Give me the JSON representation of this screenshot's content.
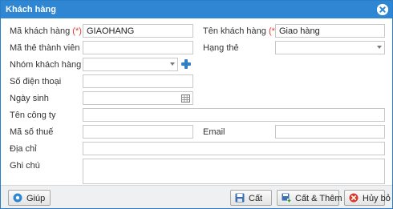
{
  "window": {
    "title": "Khách hàng"
  },
  "form": {
    "customer_code": {
      "label": "Mã khách hàng",
      "required_mark": "(*)",
      "value": "GIAOHANG"
    },
    "customer_name": {
      "label": "Tên khách hàng",
      "required_mark": "(*)",
      "value": "Giao hàng"
    },
    "member_card_code": {
      "label": "Mã thẻ thành viên",
      "value": ""
    },
    "card_tier": {
      "label": "Hạng thẻ",
      "value": ""
    },
    "customer_group": {
      "label": "Nhóm khách hàng",
      "value": ""
    },
    "phone": {
      "label": "Số điện thoại",
      "value": ""
    },
    "birthday": {
      "label": "Ngày sinh",
      "value": ""
    },
    "company": {
      "label": "Tên công ty",
      "value": ""
    },
    "tax_code": {
      "label": "Mã số thuế",
      "value": ""
    },
    "email": {
      "label": "Email",
      "value": ""
    },
    "address": {
      "label": "Địa chỉ",
      "value": ""
    },
    "note": {
      "label": "Ghi chú",
      "value": ""
    }
  },
  "footer": {
    "help_label": "Giúp",
    "save_label": "Cất",
    "save_add_label": "Cất & Thêm",
    "cancel_label": "Hủy bỏ"
  },
  "colors": {
    "accent": "#2f86d2",
    "required": "#e23b2f"
  }
}
